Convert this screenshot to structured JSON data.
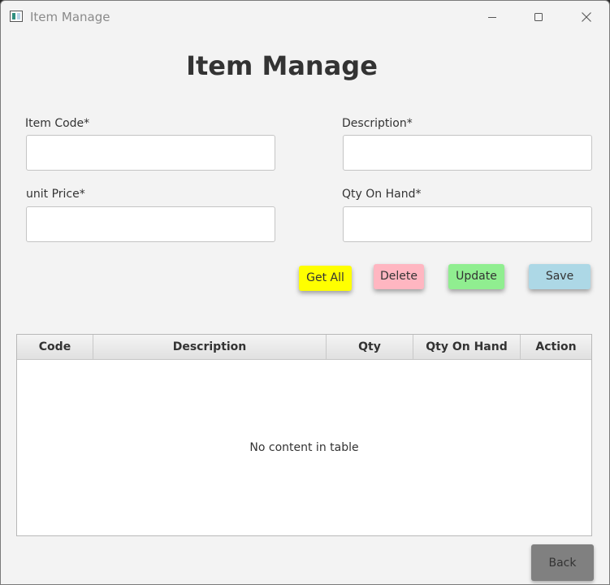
{
  "window": {
    "title": "Item Manage"
  },
  "heading": "Item Manage",
  "form": {
    "item_code": {
      "label": "Item Code*",
      "value": "",
      "placeholder": ""
    },
    "description": {
      "label": "Description*",
      "value": "",
      "placeholder": ""
    },
    "unit_price": {
      "label": "unit Price*",
      "value": "",
      "placeholder": ""
    },
    "qty_on_hand": {
      "label": "Qty On Hand*",
      "value": "",
      "placeholder": ""
    }
  },
  "buttons": {
    "get_all": {
      "label": "Get All",
      "color": "#ffff00"
    },
    "delete": {
      "label": "Delete",
      "color": "#ffb6c1"
    },
    "update": {
      "label": "Update",
      "color": "#90ee90"
    },
    "save": {
      "label": "Save",
      "color": "#add8e6"
    },
    "back": {
      "label": "Back",
      "color": "#808080"
    }
  },
  "table": {
    "columns": [
      "Code",
      "Description",
      "Qty",
      "Qty On Hand",
      "Action"
    ],
    "rows": [],
    "empty_message": "No content in table"
  }
}
